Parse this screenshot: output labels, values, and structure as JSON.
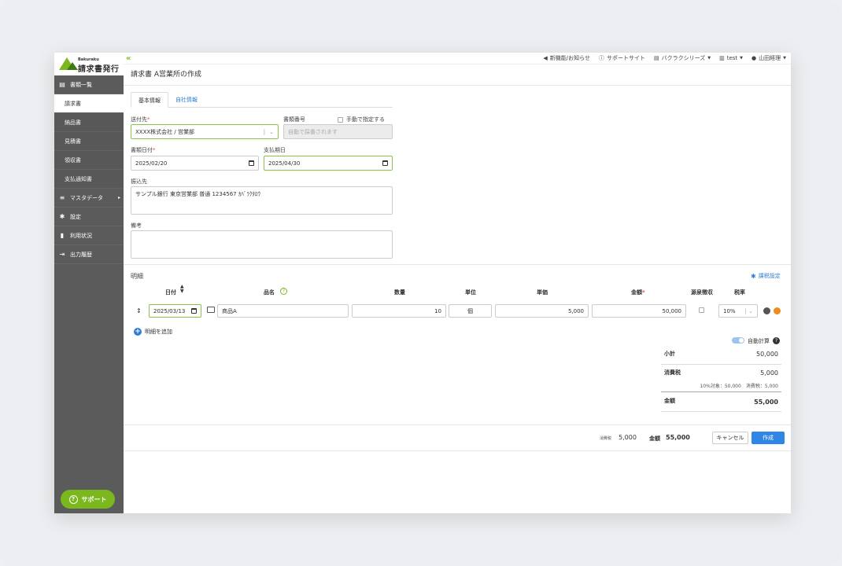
{
  "app": {
    "brand_small": "Bakuraku",
    "brand_main": "請求書発行"
  },
  "topbar": {
    "collapse": "«",
    "items": [
      {
        "icon": "megaphone-icon",
        "glyph": "📢",
        "label": "新機能/お知らせ"
      },
      {
        "icon": "help-icon",
        "glyph": "?",
        "label": "サポートサイト"
      },
      {
        "icon": "chart-icon",
        "glyph": "▤",
        "label": "バクラクシリーズ"
      },
      {
        "icon": "building-icon",
        "glyph": "▥",
        "label": "test"
      },
      {
        "icon": "user-icon",
        "glyph": "●",
        "label": "山田経理"
      }
    ]
  },
  "sidebar": {
    "items": [
      {
        "label": "書類一覧",
        "icon": "document-icon",
        "glyph": "▤"
      },
      {
        "label": "請求書",
        "sub": true,
        "active": true
      },
      {
        "label": "納品書",
        "sub": true
      },
      {
        "label": "見積書",
        "sub": true
      },
      {
        "label": "領収書",
        "sub": true
      },
      {
        "label": "支払通知書",
        "sub": true
      },
      {
        "label": "マスタデータ",
        "icon": "database-icon",
        "glyph": "≡",
        "arrow": "▸"
      },
      {
        "label": "設定",
        "icon": "gear-icon",
        "glyph": "✱"
      },
      {
        "label": "利用状況",
        "icon": "bar-chart-icon",
        "glyph": "▮"
      },
      {
        "label": "出力履歴",
        "icon": "export-icon",
        "glyph": "⇥"
      }
    ],
    "support_label": "サポート",
    "support_glyph": "?"
  },
  "page": {
    "title": "請求書 A営業所の作成",
    "tabs": [
      "基本情報",
      "自社情報"
    ]
  },
  "form": {
    "recipient_label": "送付先",
    "recipient_value": "XXXX株式会社 / 営業部",
    "docno_label": "書類番号",
    "manual_label": "手動で指定する",
    "docno_placeholder": "自動で採番されます",
    "date_label": "書類日付",
    "date_value": "2025/02/20",
    "due_label": "支払期日",
    "due_value": "2025/04/30",
    "bank_label": "振込先",
    "bank_value": "サンプル銀行 東京営業部 普通 1234567 ｶﾊﾞﾗｸﾀﾛｳ",
    "note_label": "備考",
    "note_value": "",
    "required_mark": "*"
  },
  "lines": {
    "section_label": "明細",
    "tax_settings": "課税設定",
    "headers": {
      "date": "日付",
      "name": "品名",
      "qty": "数量",
      "unit": "単位",
      "price": "単価",
      "amount": "金額",
      "withholding": "源泉徴収",
      "rate": "税率"
    },
    "rows": [
      {
        "date": "2025/03/13",
        "name": "商品A",
        "qty": "10",
        "unit": "個",
        "price": "5,000",
        "amount": "50,000",
        "rate": "10%"
      }
    ],
    "add_label": "明細を追加"
  },
  "summary": {
    "auto_calc": "自動計算",
    "subtotal_label": "小計",
    "subtotal": "50,000",
    "tax_label": "消費税",
    "tax": "5,000",
    "tax_detail": "10%対象：50,000　消費税：5,000",
    "total_label": "金額",
    "total": "55,000"
  },
  "footer": {
    "tax_label": "消費税",
    "tax_value": "5,000",
    "total_label": "金額",
    "total_value": "55,000",
    "cancel": "キャンセル",
    "create": "作成"
  },
  "colors": {
    "accent_green": "#7ab81d",
    "primary_blue": "#2f86e6",
    "sidebar_bg": "#5b5b5b"
  }
}
